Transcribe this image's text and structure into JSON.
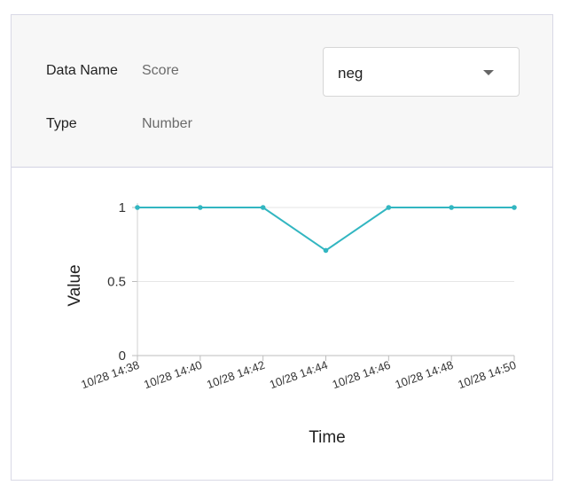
{
  "info": {
    "data_name_label": "Data Name",
    "data_name_value": "Score",
    "type_label": "Type",
    "type_value": "Number"
  },
  "selector": {
    "selected": "neg"
  },
  "colors": {
    "line": "#32b6c1",
    "grid": "#e6e6e6",
    "header_bg": "#f7f7f7"
  },
  "chart_data": {
    "type": "line",
    "x": [
      "10/28 14:38",
      "10/28 14:40",
      "10/28 14:42",
      "10/28 14:44",
      "10/28 14:46",
      "10/28 14:48",
      "10/28 14:50"
    ],
    "series": [
      {
        "values": [
          1,
          1,
          1,
          0.71,
          1,
          1,
          1
        ]
      }
    ],
    "xlabel": "Time",
    "ylabel": "Value",
    "ylim": [
      0,
      1
    ],
    "yticks": [
      0,
      0.5,
      1
    ],
    "grid": true
  }
}
